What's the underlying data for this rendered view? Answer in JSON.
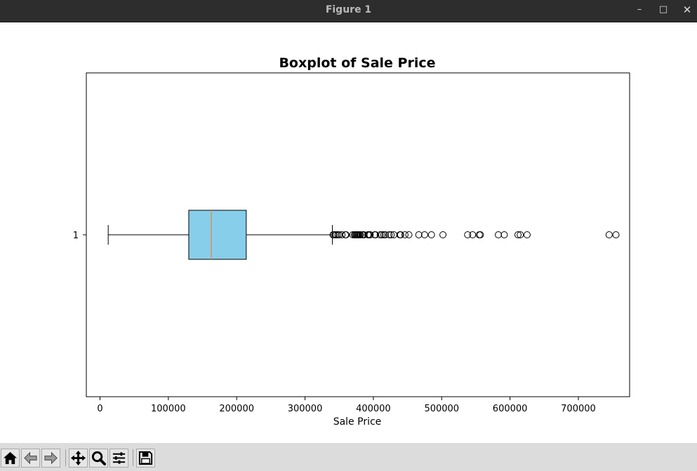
{
  "window": {
    "title": "Figure 1",
    "minimize_glyph": "–",
    "maximize_glyph": "□",
    "close_glyph": "✕"
  },
  "toolbar": {
    "buttons": [
      {
        "name": "home-icon",
        "tooltip": "Reset original view"
      },
      {
        "name": "back-arrow-icon",
        "tooltip": "Back to previous view"
      },
      {
        "name": "forward-arrow-icon",
        "tooltip": "Forward to next view"
      },
      {
        "name": "pan-move-icon",
        "tooltip": "Pan axes"
      },
      {
        "name": "zoom-magnifier-icon",
        "tooltip": "Zoom to rectangle"
      },
      {
        "name": "subplots-sliders-icon",
        "tooltip": "Configure subplots"
      },
      {
        "name": "save-disk-icon",
        "tooltip": "Save the figure"
      }
    ]
  },
  "chart_data": {
    "type": "boxplot",
    "title": "Boxplot of Sale Price",
    "xlabel": "Sale Price",
    "ylabel": "",
    "orientation": "horizontal",
    "xlim": [
      -20000,
      775000
    ],
    "xticks": [
      0,
      100000,
      200000,
      300000,
      400000,
      500000,
      600000,
      700000
    ],
    "xtick_labels": [
      "0",
      "100000",
      "200000",
      "300000",
      "400000",
      "500000",
      "600000",
      "700000"
    ],
    "ytick_labels": [
      "1"
    ],
    "grid": false,
    "colors": {
      "box_fill": "#87ceeb",
      "median": "#e8873a",
      "edge": "#000000"
    },
    "boxes": [
      {
        "label": "1",
        "whisker_low": 12000,
        "q1": 129900,
        "median": 163000,
        "q3": 214000,
        "whisker_high": 340000,
        "outliers": [
          341000,
          342643,
          345000,
          345474,
          348000,
          350000,
          354000,
          359100,
          360000,
          369900,
          372402,
          372500,
          374000,
          375000,
          376162,
          377426,
          377500,
          378500,
          380000,
          381000,
          383970,
          385000,
          386250,
          392000,
          392500,
          394432,
          395000,
          395192,
          402000,
          402861,
          403000,
          410000,
          412500,
          415298,
          417500,
          423000,
          426000,
          430000,
          438780,
          440000,
          446261,
          451950,
          466500,
          475000,
          485000,
          501837,
          538000,
          545224,
          555000,
          556581,
          582933,
          591587,
          611657,
          615000,
          625000,
          745000,
          755000
        ]
      }
    ]
  }
}
